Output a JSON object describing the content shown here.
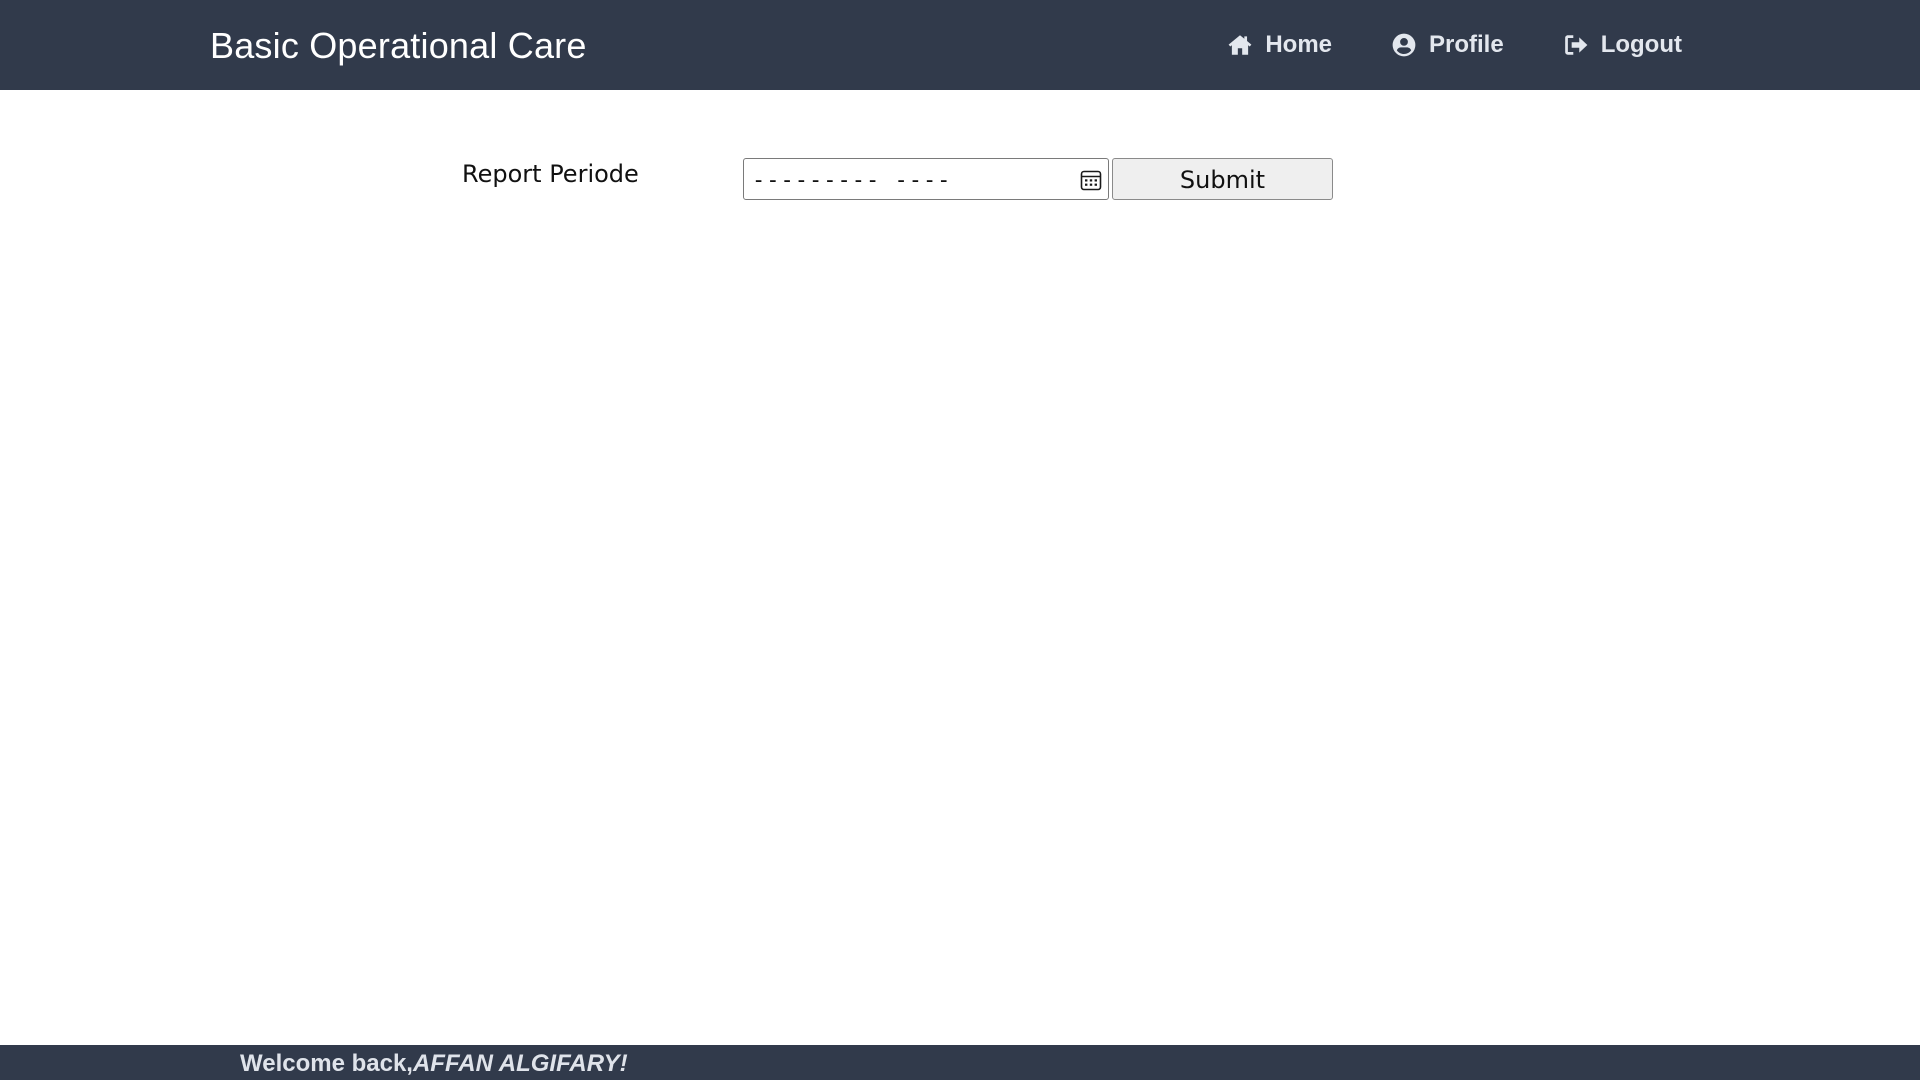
{
  "app": {
    "brand": "Basic Operational Care"
  },
  "nav": {
    "items": [
      {
        "label": "Home",
        "icon": "home-icon"
      },
      {
        "label": "Profile",
        "icon": "user-circle-icon"
      },
      {
        "label": "Logout",
        "icon": "sign-out-icon"
      }
    ]
  },
  "form": {
    "period_label": "Report Periode",
    "period_value": "--------- ----",
    "period_icon": "calendar-icon",
    "submit_label": "Submit"
  },
  "footer": {
    "welcome_prefix": "Welcome back,",
    "user_name": "AFFAN ALGIFARY!"
  },
  "colors": {
    "navbar_bg": "#313a4b",
    "nav_text": "#e3e7ee",
    "page_bg": "#ffffff",
    "button_bg": "#efefef"
  }
}
